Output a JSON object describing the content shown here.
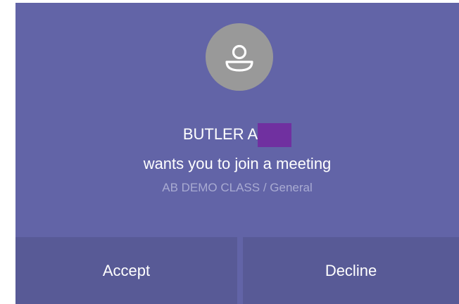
{
  "call": {
    "caller_name": "BUTLER A",
    "message": "wants you to join a meeting",
    "channel": "AB DEMO CLASS / General"
  },
  "actions": {
    "accept_label": "Accept",
    "decline_label": "Decline"
  },
  "icons": {
    "avatar": "person-icon"
  },
  "colors": {
    "background": "#6264a7",
    "button": "#585a96",
    "avatar": "#999999",
    "redaction": "#7030a0",
    "secondary_text": "#a9abd2"
  }
}
